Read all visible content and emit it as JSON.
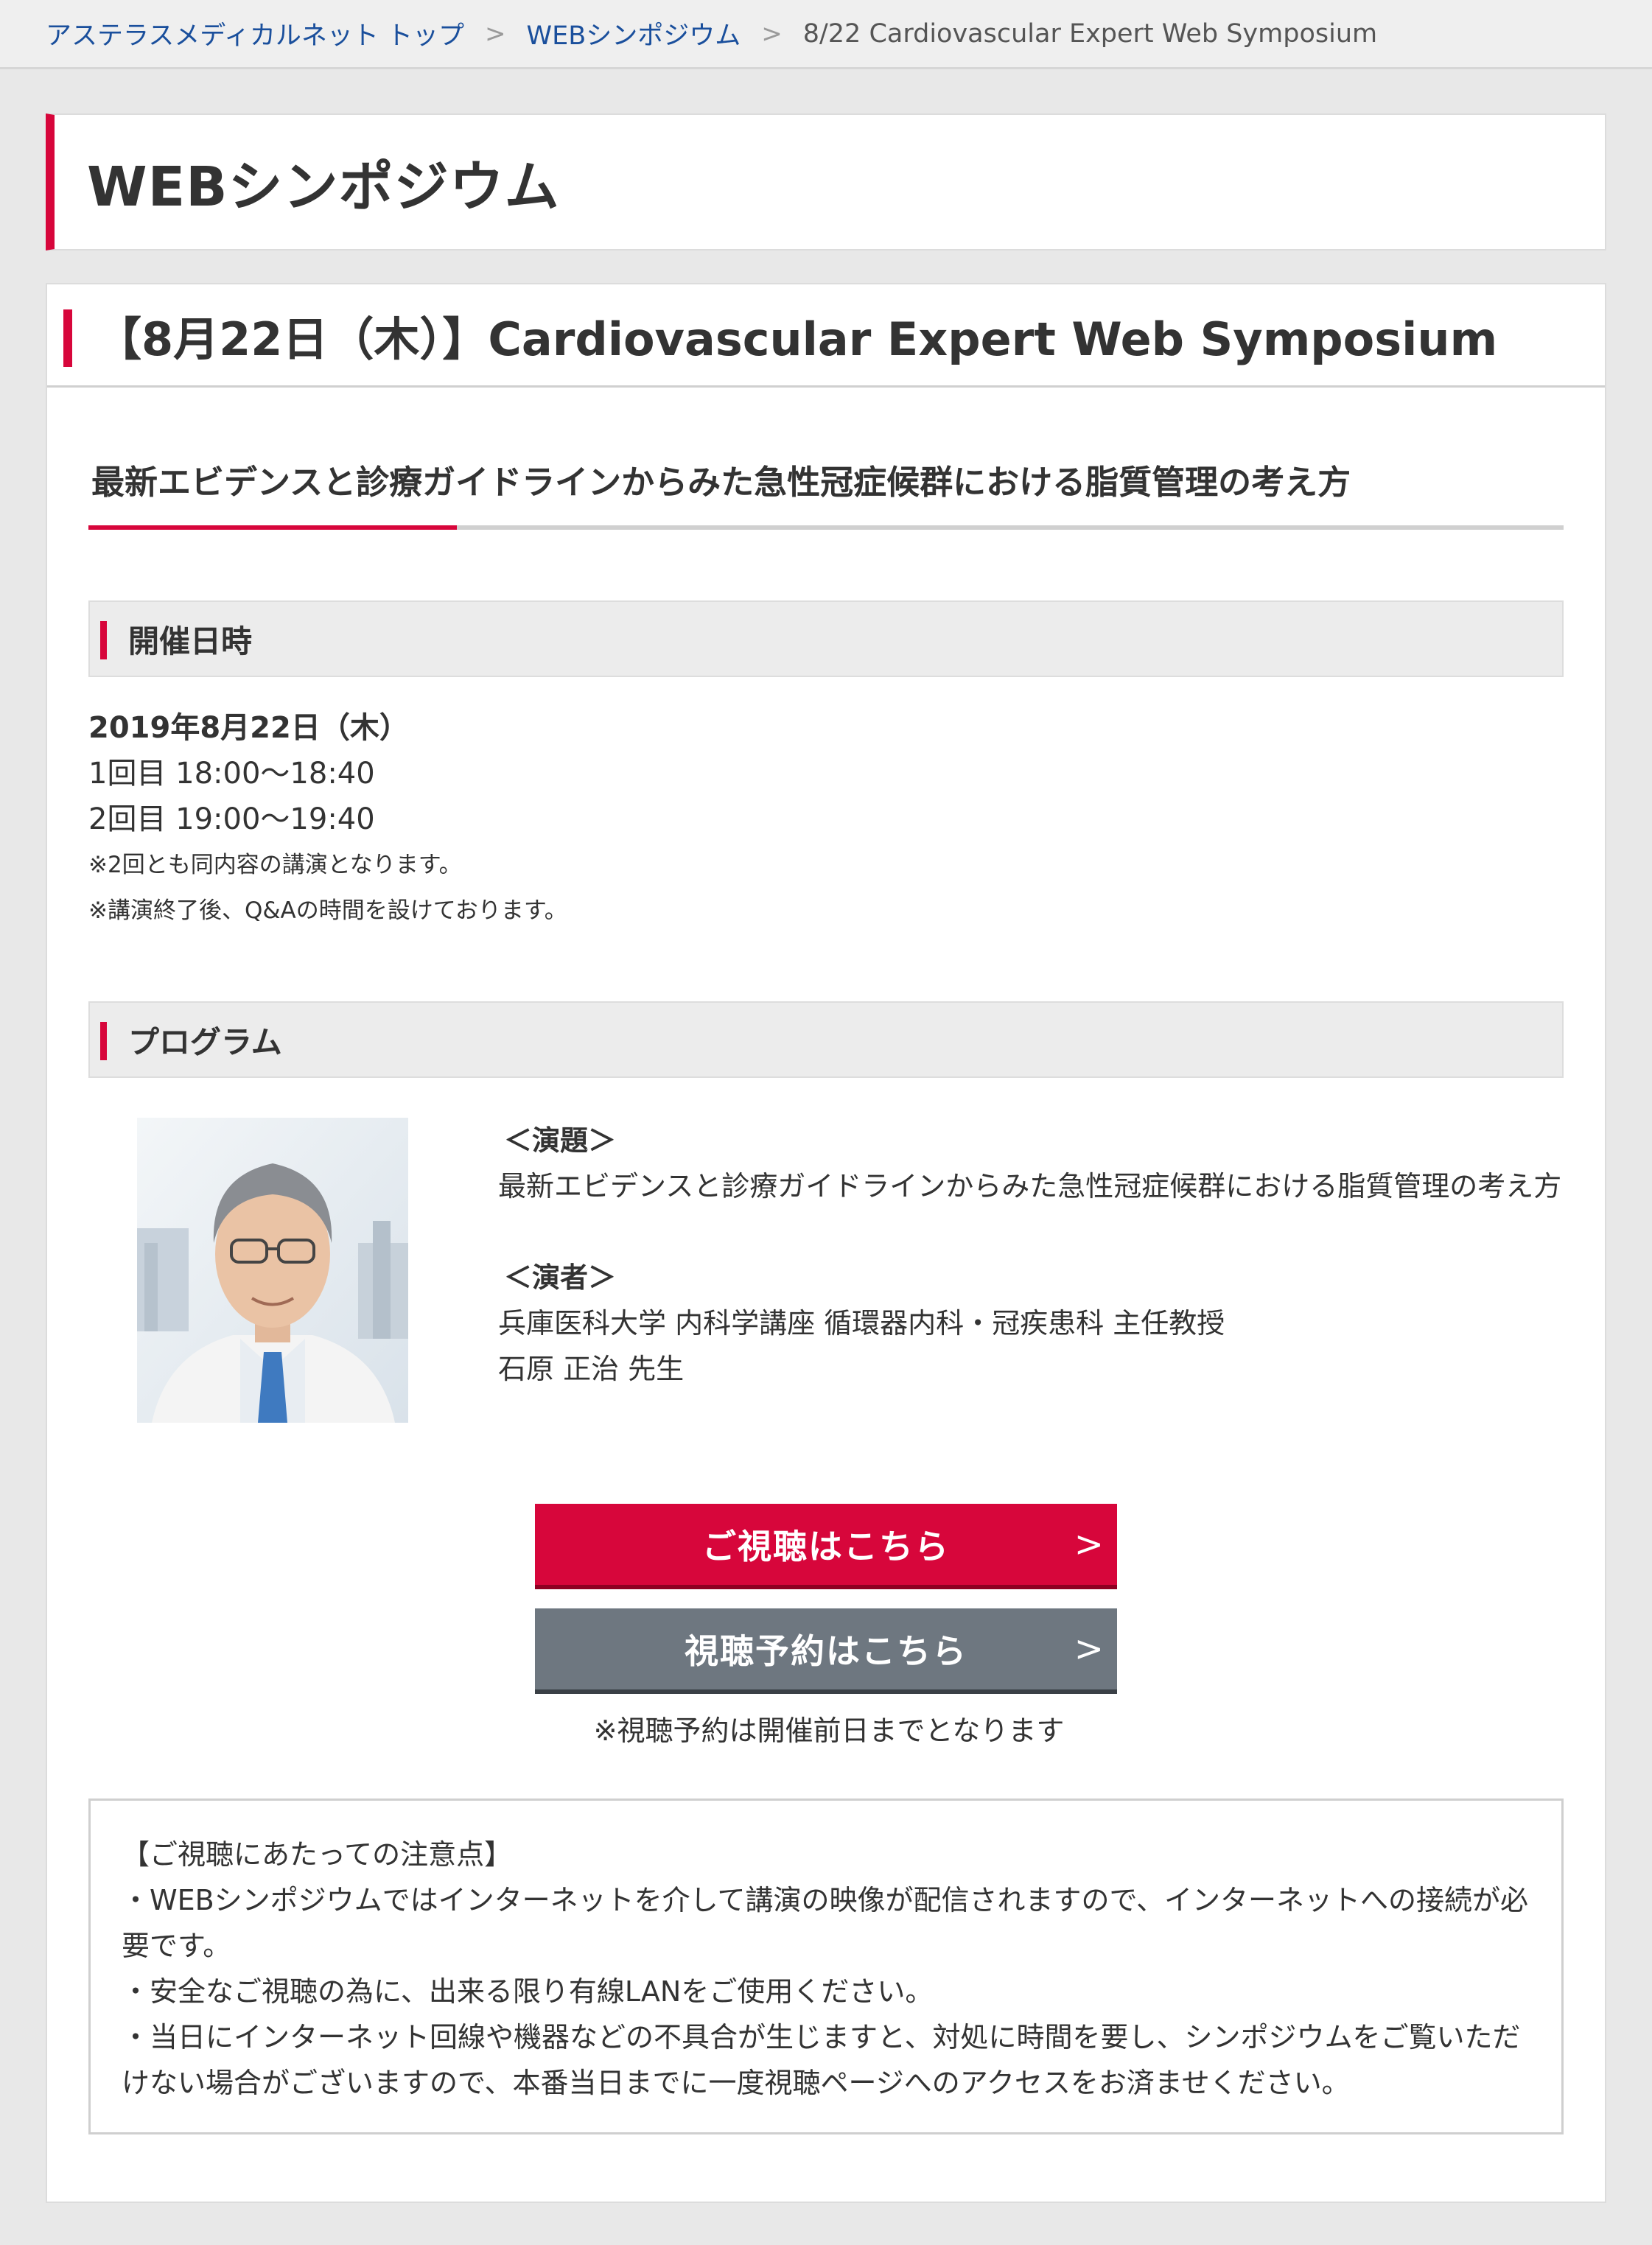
{
  "breadcrumb": {
    "home": "アステラスメディカルネット トップ",
    "section": "WEBシンポジウム",
    "current": "8/22 Cardiovascular Expert Web Symposium",
    "separator": ">"
  },
  "page_title": "WEBシンポジウム",
  "event": {
    "title": "【8月22日（木）】Cardiovascular Expert Web Symposium",
    "lecture_title": "最新エビデンスと診療ガイドラインからみた急性冠症候群における脂質管理の考え方"
  },
  "schedule": {
    "heading": "開催日時",
    "date": "2019年8月22日（木）",
    "session1": "1回目 18:00〜18:40",
    "session2": "2回目 19:00〜19:40",
    "note1": "※2回とも同内容の講演となります。",
    "note2": "※講演終了後、Q&Aの時間を設けております。"
  },
  "program": {
    "heading": "プログラム",
    "topic_label": "＜演題＞",
    "topic": "最新エビデンスと診療ガイドラインからみた急性冠症候群における脂質管理の考え方",
    "speaker_label": "＜演者＞",
    "speaker_affiliation": "兵庫医科大学 内科学講座 循環器内科・冠疾患科 主任教授",
    "speaker_name": "石原 正治 先生"
  },
  "buttons": {
    "watch_label": "ご視聴はこちら",
    "reserve_label": "視聴予約はこちら",
    "chevron": ">",
    "reserve_note": "※視聴予約は開催前日までとなります"
  },
  "notice": {
    "heading": "【ご視聴にあたっての注意点】",
    "item1": "・WEBシンポジウムではインターネットを介して講演の映像が配信されますので、インターネットへの接続が必要です。",
    "item2": "・安全なご視聴の為に、出来る限り有線LANをご使用ください。",
    "item3": "・当日にインターネット回線や機器などの不具合が生じますと、対処に時間を要し、シンポジウムをご覧いただけない場合がございますので、本番当日までに一度視聴ページへのアクセスをお済ませください。"
  },
  "colors": {
    "accent": "#d7063b",
    "link": "#1a4f9c",
    "button_secondary": "#6e7780",
    "background": "#e8e8e8"
  }
}
